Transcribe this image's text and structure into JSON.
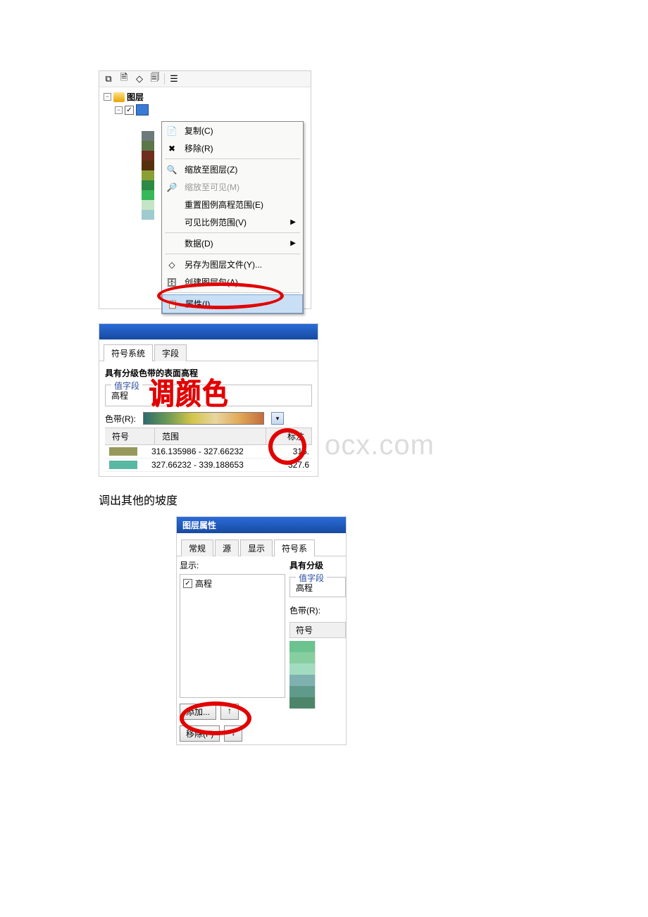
{
  "panel1": {
    "tree_label": "图层",
    "swatch_colors": [
      "#6e7a7a",
      "#5c7747",
      "#6e2f1c",
      "#56300e",
      "#8aa035",
      "#2c8a44",
      "#37b85a",
      "#c3e5c5",
      "#9fcad0"
    ],
    "context_menu": {
      "copy": "复制(C)",
      "remove": "移除(R)",
      "zoom_layer": "缩放至图层(Z)",
      "zoom_visible": "缩放至可见(M)",
      "reset_legend": "重置图例高程范围(E)",
      "visible_scale": "可见比例范围(V)",
      "data": "数据(D)",
      "save_as_layer": "另存为图层文件(Y)...",
      "create_pkg": "创建图层包(A)...",
      "properties": "属性(I)..."
    }
  },
  "panel2": {
    "tab1": "符号系统",
    "tab2": "字段",
    "title": "具有分级色带的表面高程",
    "fieldset_title": "值字段",
    "field_value": "高程",
    "ramp_label": "色带(R):",
    "head_symbol": "符号",
    "head_range": "范围",
    "head_label": "标注",
    "rows": [
      {
        "color": "#96995b",
        "range": "316.135986 - 327.66232",
        "label": "316."
      },
      {
        "color": "#58b8a3",
        "range": "327.66232 - 339.188653",
        "label": "327.6"
      }
    ],
    "annotation": "调颜色",
    "watermark": "ocx.com"
  },
  "caption": "调出其他的坡度",
  "panel3": {
    "title": "图层属性",
    "tabs": {
      "general": "常规",
      "source": "源",
      "display": "显示",
      "symbol": "符号系"
    },
    "show_label": "显示:",
    "list_item": "高程",
    "add_btn": "添加...",
    "remove_btn": "移除(F)",
    "right_title": "具有分级",
    "fieldset_title": "值字段",
    "field_value": "高程",
    "ramp_label": "色带(R):",
    "head_symbol": "符号",
    "swatch_colors": [
      "#6cc38f",
      "#87cfa0",
      "#a2dcc0",
      "#7fb1b0",
      "#5f9a8b",
      "#4c8569"
    ]
  }
}
